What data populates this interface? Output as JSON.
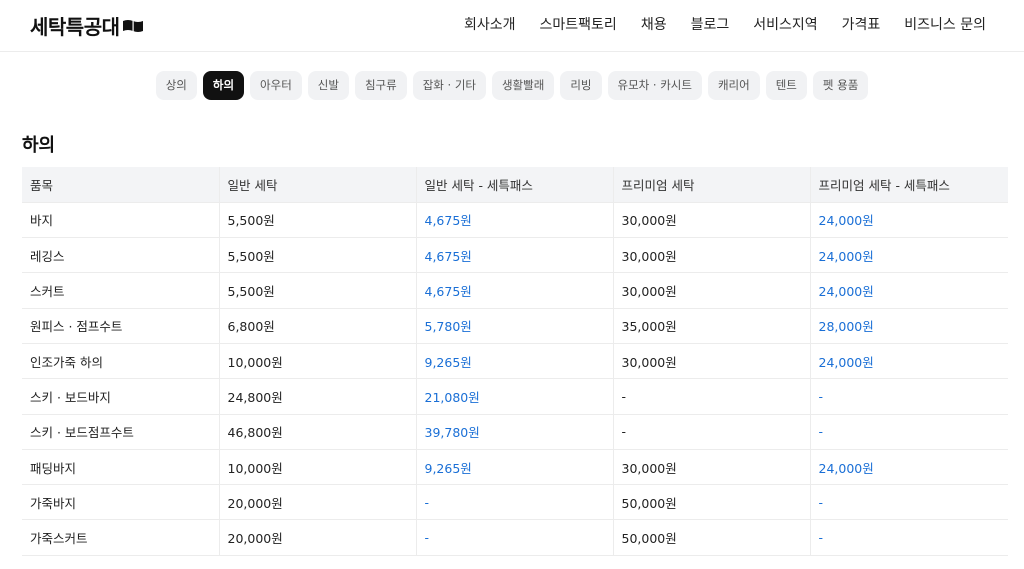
{
  "header": {
    "logo_text": "세탁특공대",
    "nav": [
      "회사소개",
      "스마트팩토리",
      "채용",
      "블로그",
      "서비스지역",
      "가격표",
      "비즈니스 문의"
    ]
  },
  "categories": {
    "items": [
      "상의",
      "하의",
      "아우터",
      "신발",
      "침구류",
      "잡화 · 기타",
      "생활빨래",
      "리빙",
      "유모차 · 카시트",
      "캐리어",
      "텐트",
      "펫 용품"
    ],
    "active_index": 1
  },
  "section": {
    "title": "하의"
  },
  "table": {
    "headers": [
      "품목",
      "일반 세탁",
      "일반 세탁 - 세특패스",
      "프리미엄 세탁",
      "프리미엄 세탁 - 세특패스"
    ],
    "rows": [
      [
        "바지",
        "5,500원",
        "4,675원",
        "30,000원",
        "24,000원"
      ],
      [
        "레깅스",
        "5,500원",
        "4,675원",
        "30,000원",
        "24,000원"
      ],
      [
        "스커트",
        "5,500원",
        "4,675원",
        "30,000원",
        "24,000원"
      ],
      [
        "원피스 · 점프수트",
        "6,800원",
        "5,780원",
        "35,000원",
        "28,000원"
      ],
      [
        "인조가죽 하의",
        "10,000원",
        "9,265원",
        "30,000원",
        "24,000원"
      ],
      [
        "스키 · 보드바지",
        "24,800원",
        "21,080원",
        "-",
        "-"
      ],
      [
        "스키 · 보드점프수트",
        "46,800원",
        "39,780원",
        "-",
        "-"
      ],
      [
        "패딩바지",
        "10,000원",
        "9,265원",
        "30,000원",
        "24,000원"
      ],
      [
        "가죽바지",
        "20,000원",
        "-",
        "50,000원",
        "-"
      ],
      [
        "가죽스커트",
        "20,000원",
        "-",
        "50,000원",
        "-"
      ]
    ]
  },
  "colors": {
    "pass_text": "#1a6fd6",
    "active_chip": "#111111",
    "chip_bg": "#f1f2f4"
  }
}
